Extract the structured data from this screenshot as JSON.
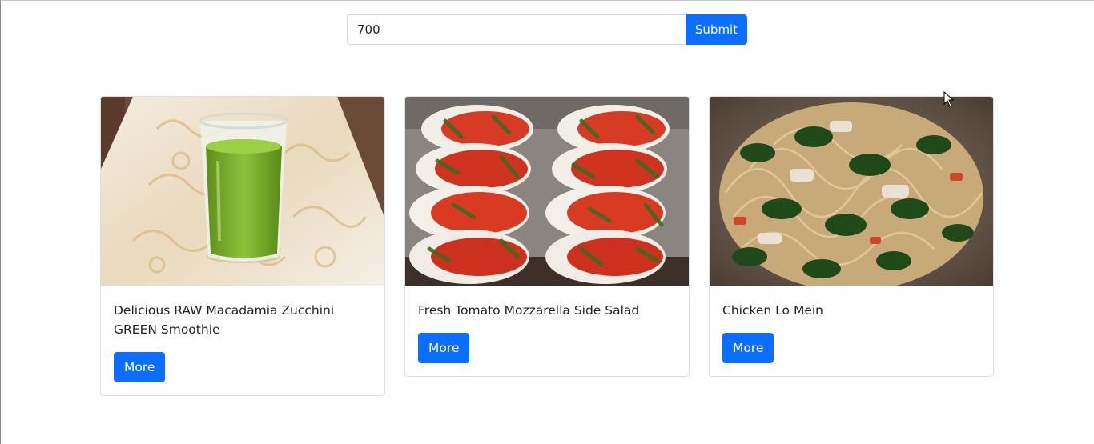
{
  "search": {
    "value": "700",
    "submit_label": "Submit"
  },
  "cards": [
    {
      "title": "Delicious RAW Macadamia Zucchini GREEN Smoothie",
      "image": "green-smoothie-glass",
      "button_label": "More"
    },
    {
      "title": "Fresh Tomato Mozzarella Side Salad",
      "image": "tomato-mozzarella-basil",
      "button_label": "More"
    },
    {
      "title": "Chicken Lo Mein",
      "image": "chicken-lo-mein-bowl",
      "button_label": "More"
    }
  ],
  "colors": {
    "primary": "#0d6efd",
    "card_border": "#dfdfdf",
    "text": "#212529"
  }
}
